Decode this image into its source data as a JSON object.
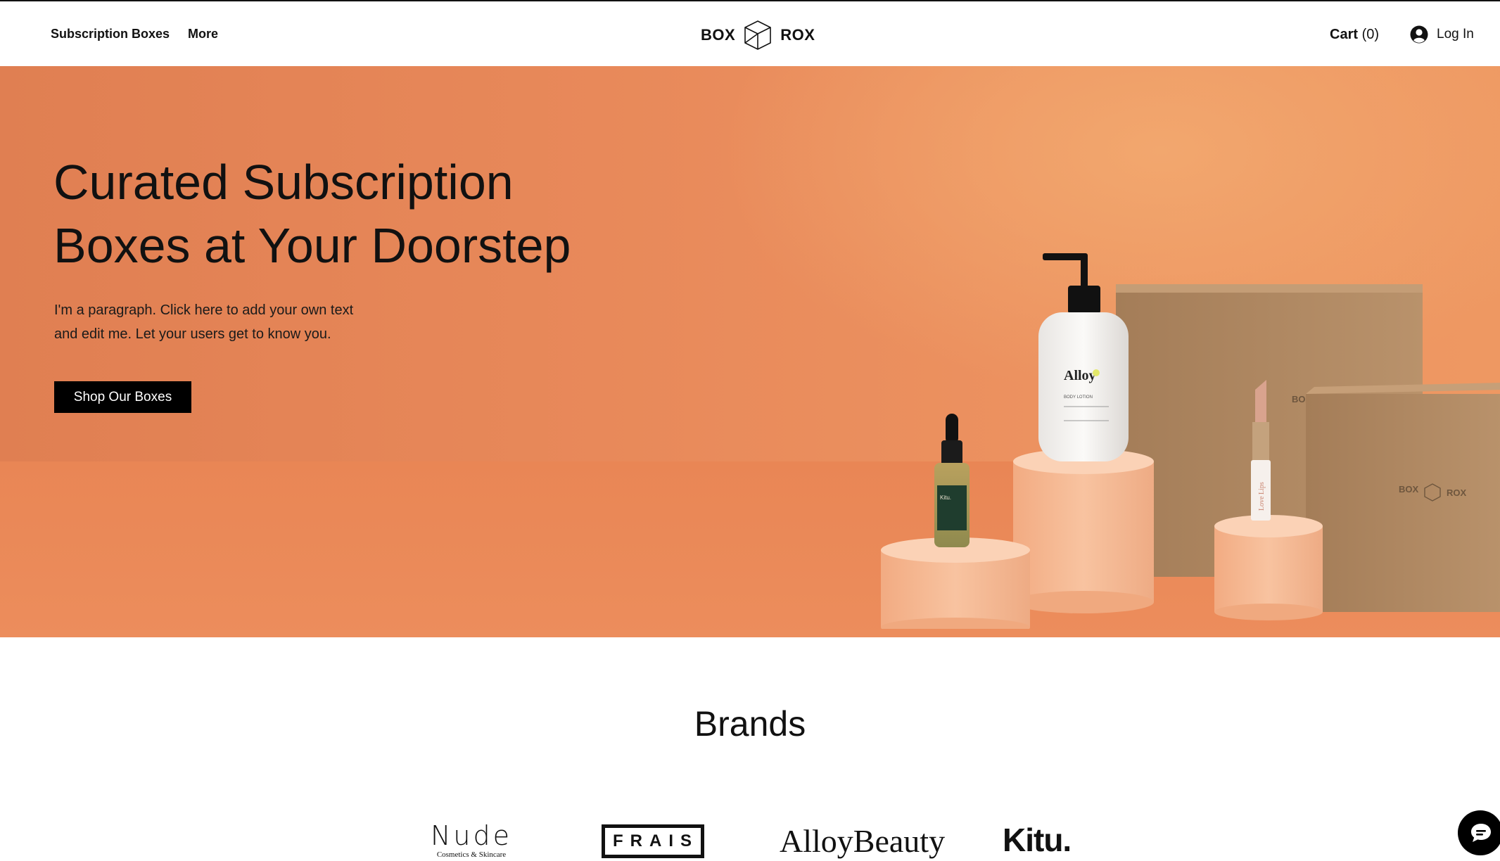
{
  "header": {
    "nav": [
      "Subscription Boxes",
      "More"
    ],
    "logo": {
      "left": "BOX",
      "right": "ROX",
      "icon": "cube-icon"
    },
    "cart": {
      "label": "Cart",
      "count": "(0)"
    },
    "login": {
      "label": "Log In",
      "icon": "user-avatar-icon"
    }
  },
  "hero": {
    "title_line1": "Curated Subscription",
    "title_line2": "Boxes at Your Doorstep",
    "paragraph_line1": "I'm a paragraph. Click here to add your own text",
    "paragraph_line2": "and edit me. Let your users get to know you.",
    "cta": "Shop Our Boxes",
    "product_labels": {
      "alloy": "Alloy",
      "alloy_type": "BODY LOTION",
      "box_brand_left": "BOX",
      "box_brand_right": "ROX",
      "box_back_text": "BOX",
      "kitu": "Kitu.",
      "lipstick": "Love Lips"
    },
    "colors": {
      "background": "#e8895a",
      "pedestal": "#f4b892",
      "box": "#b48a62"
    }
  },
  "brands": {
    "title": "Brands",
    "items": [
      {
        "name": "Nude",
        "subtitle": "Cosmetics & Skincare"
      },
      {
        "name": "FRAIS"
      },
      {
        "name": "AlloyBeauty"
      },
      {
        "name": "Kitu."
      }
    ]
  },
  "chat": {
    "icon": "chat-bubble-icon"
  }
}
